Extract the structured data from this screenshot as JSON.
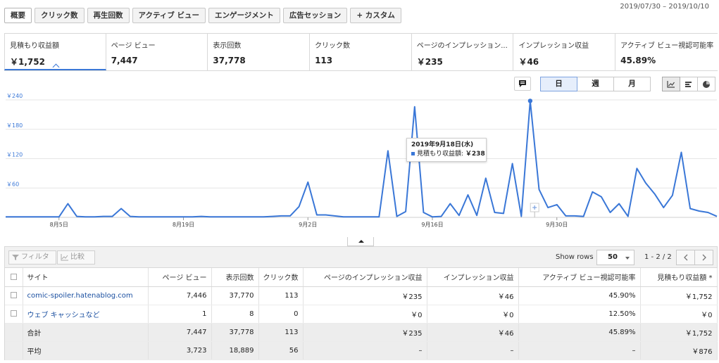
{
  "tabs": [
    {
      "label": "概要",
      "active": true
    },
    {
      "label": "クリック数"
    },
    {
      "label": "再生回数"
    },
    {
      "label": "アクティブ ビュー"
    },
    {
      "label": "エンゲージメント"
    },
    {
      "label": "広告セッション"
    },
    {
      "label": "+ カスタム"
    }
  ],
  "date_range": "2019/07/30 – 2019/10/10",
  "metrics": [
    {
      "label": "見積もり収益額",
      "value": "￥1,752",
      "active": true
    },
    {
      "label": "ページ ビュー",
      "value": "7,447"
    },
    {
      "label": "表示回数",
      "value": "37,778"
    },
    {
      "label": "クリック数",
      "value": "113"
    },
    {
      "label": "ページのインプレッション...",
      "value": "￥235"
    },
    {
      "label": "インプレッション収益",
      "value": "￥46"
    },
    {
      "label": "アクティブ ビュー視認可能率",
      "value": "45.89%"
    }
  ],
  "period_buttons": [
    {
      "label": "日",
      "active": true
    },
    {
      "label": "週"
    },
    {
      "label": "月"
    }
  ],
  "chart_type_icons": [
    "line-chart-icon",
    "bar-chart-icon",
    "pie-chart-icon"
  ],
  "chart_data": {
    "type": "line",
    "y_ticks": [
      "￥240",
      "￥180",
      "￥120",
      "￥60"
    ],
    "y_tick_values": [
      240,
      180,
      120,
      60
    ],
    "ylim": [
      0,
      240
    ],
    "x_ticks": [
      {
        "label": "8月5日",
        "index": 6
      },
      {
        "label": "8月19日",
        "index": 20
      },
      {
        "label": "9月2日",
        "index": 34
      },
      {
        "label": "9月16日",
        "index": 48
      },
      {
        "label": "9月30日",
        "index": 62
      }
    ],
    "series": [
      {
        "name": "見積もり収益額",
        "color": "#3a77d7",
        "values": [
          1,
          1,
          1,
          1,
          1,
          1,
          1,
          28,
          2,
          1,
          1,
          2,
          2,
          18,
          2,
          1,
          1,
          1,
          1,
          1,
          1,
          1,
          2,
          1,
          1,
          1,
          1,
          1,
          1,
          1,
          2,
          3,
          3,
          22,
          72,
          5,
          5,
          3,
          1,
          1,
          1,
          1,
          1,
          136,
          2,
          12,
          226,
          10,
          1,
          2,
          28,
          4,
          46,
          4,
          80,
          10,
          8,
          110,
          2,
          238,
          57,
          20,
          26,
          3,
          3,
          2,
          52,
          42,
          10,
          28,
          2,
          100,
          70,
          48,
          20,
          45,
          133,
          18,
          13,
          10,
          2
        ]
      }
    ],
    "tooltip": {
      "title": "2019年9月18日(水)",
      "series": "見積もり収益額:",
      "value": "￥238",
      "index": 59
    },
    "grid": true
  },
  "table": {
    "filter_label": "フィルタ",
    "compare_label": "比較",
    "show_rows_label": "Show rows",
    "rows_value": "50",
    "page_info": "1 - 2 / 2",
    "headers": [
      "サイト",
      "ページ ビュー",
      "表示回数",
      "クリック数",
      "ページのインプレッション収益",
      "インプレッション収益",
      "アクティブ ビュー視認可能率",
      "見積もり収益額 *"
    ],
    "rows": [
      [
        "comic-spoiler.hatenablog.com",
        "7,446",
        "37,770",
        "113",
        "￥235",
        "￥46",
        "45.90%",
        "￥1,752"
      ],
      [
        "ウェブ キャッシュなど",
        "1",
        "8",
        "0",
        "￥0",
        "￥0",
        "12.50%",
        "￥0"
      ]
    ],
    "total": [
      "合計",
      "7,447",
      "37,778",
      "113",
      "￥235",
      "￥46",
      "45.89%",
      "￥1,752"
    ],
    "average": [
      "平均",
      "3,723",
      "18,889",
      "56",
      "–",
      "–",
      "–",
      "￥876"
    ]
  }
}
